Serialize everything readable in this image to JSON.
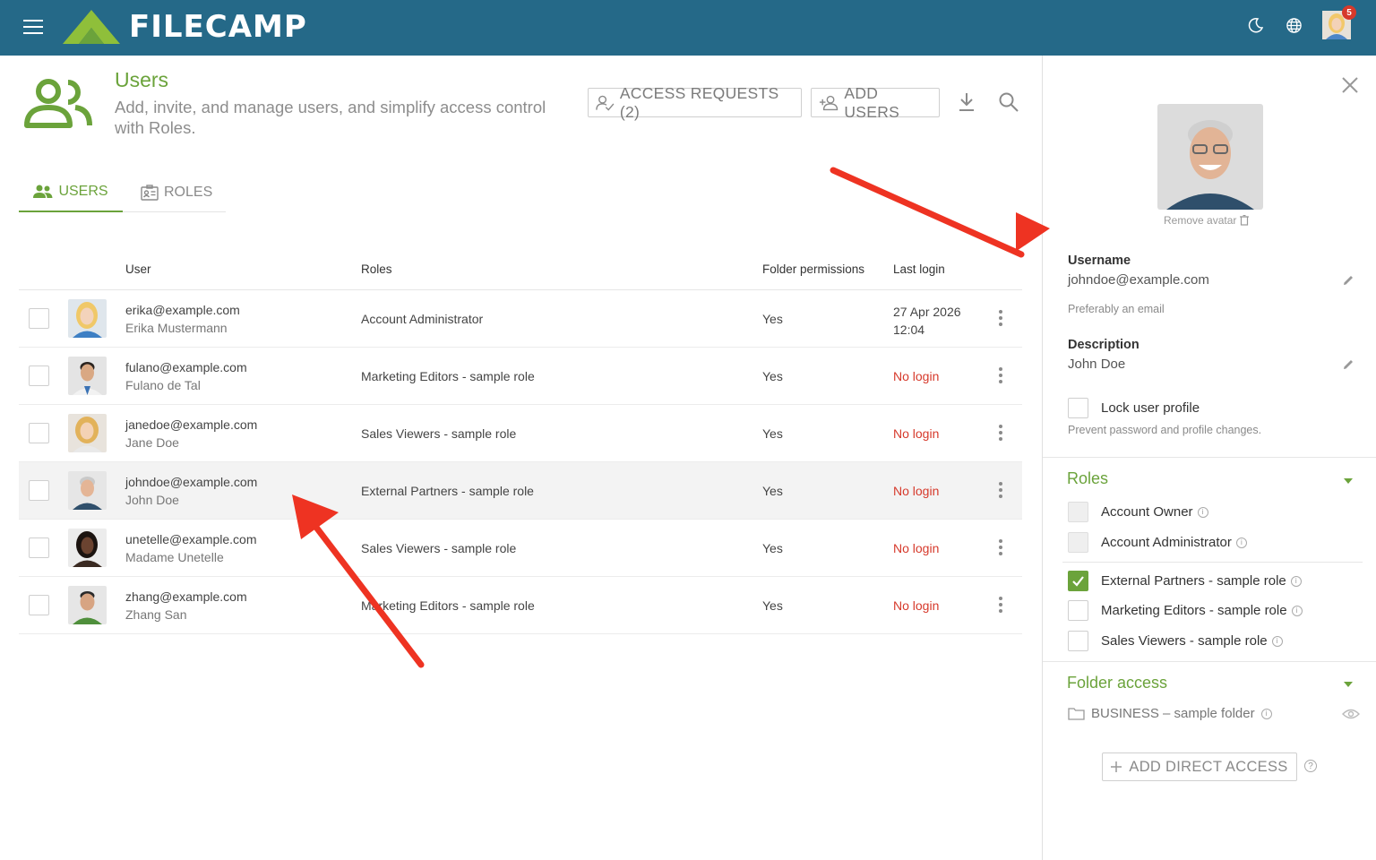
{
  "app": {
    "logo_text": "FILECAMP",
    "notification_count": "5"
  },
  "colors": {
    "topbar": "#256988",
    "accent_green": "#6ba33b",
    "no_login_red": "#d6392b"
  },
  "header": {
    "title": "Users",
    "subtitle": "Add, invite, and manage users, and simplify access control with Roles.",
    "access_requests_label": "ACCESS REQUESTS (2)",
    "add_users_label": "ADD USERS"
  },
  "tabs": [
    {
      "label": "USERS",
      "active": true,
      "icon": "users-icon"
    },
    {
      "label": "ROLES",
      "active": false,
      "icon": "id-card-icon"
    }
  ],
  "table": {
    "columns": [
      "User",
      "Roles",
      "Folder permissions",
      "Last login"
    ],
    "rows": [
      {
        "email": "erika@example.com",
        "name": "Erika Mustermann",
        "role": "Account Administrator",
        "perm": "Yes",
        "login": "27 Apr 2026 12:04",
        "no_login": false
      },
      {
        "email": "fulano@example.com",
        "name": "Fulano de Tal",
        "role": "Marketing Editors - sample role",
        "perm": "Yes",
        "login": "No login",
        "no_login": true
      },
      {
        "email": "janedoe@example.com",
        "name": "Jane Doe",
        "role": "Sales Viewers - sample role",
        "perm": "Yes",
        "login": "No login",
        "no_login": true
      },
      {
        "email": "johndoe@example.com",
        "name": "John Doe",
        "role": "External Partners - sample role",
        "perm": "Yes",
        "login": "No login",
        "no_login": true,
        "selected": true
      },
      {
        "email": "unetelle@example.com",
        "name": "Madame Unetelle",
        "role": "Sales Viewers - sample role",
        "perm": "Yes",
        "login": "No login",
        "no_login": true
      },
      {
        "email": "zhang@example.com",
        "name": "Zhang San",
        "role": "Marketing Editors - sample role",
        "perm": "Yes",
        "login": "No login",
        "no_login": true
      }
    ]
  },
  "drawer": {
    "remove_avatar": "Remove avatar",
    "username_label": "Username",
    "username_value": "johndoe@example.com",
    "username_hint": "Preferably an email",
    "description_label": "Description",
    "description_value": "John Doe",
    "lock_label": "Lock user profile",
    "lock_hint": "Prevent password and profile changes.",
    "roles_title": "Roles",
    "roles": [
      {
        "label": "Account Owner",
        "state": "disabled"
      },
      {
        "label": "Account Administrator",
        "state": "disabled"
      },
      {
        "label": "External Partners - sample role",
        "state": "checked"
      },
      {
        "label": "Marketing Editors - sample role",
        "state": "unchecked"
      },
      {
        "label": "Sales Viewers - sample role",
        "state": "unchecked"
      }
    ],
    "folder_title": "Folder access",
    "folder_name": "BUSINESS – sample folder",
    "add_direct_label": "ADD DIRECT ACCESS"
  }
}
